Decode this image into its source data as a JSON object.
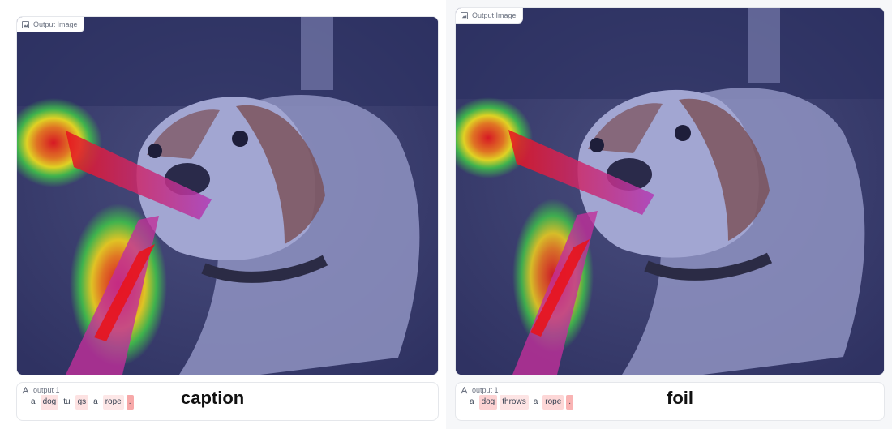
{
  "panels": [
    {
      "image_label": "Output Image",
      "text_label": "output 1",
      "tokens": [
        {
          "text": "a",
          "bg": "#ffffff"
        },
        {
          "text": "dog",
          "bg": "#fde2e2"
        },
        {
          "text": "tu",
          "bg": "#ffffff"
        },
        {
          "text": "gs",
          "bg": "#fde2e2"
        },
        {
          "text": "a",
          "bg": "#ffffff"
        },
        {
          "text": "rope",
          "bg": "#fde7e7"
        },
        {
          "text": ".",
          "bg": "#f7a8a8"
        }
      ],
      "caption": "caption"
    },
    {
      "image_label": "Output Image",
      "text_label": "output 1",
      "tokens": [
        {
          "text": "a",
          "bg": "#ffffff"
        },
        {
          "text": "dog",
          "bg": "#fcd2d2"
        },
        {
          "text": "throws",
          "bg": "#fde4e4"
        },
        {
          "text": "a",
          "bg": "#ffffff"
        },
        {
          "text": "rope",
          "bg": "#fdd7d7"
        },
        {
          "text": ".",
          "bg": "#f9b3b3"
        }
      ],
      "caption": "foil"
    }
  ],
  "colors": {
    "overlay": "#3d4170",
    "heat_red": "#e8141c",
    "heat_yellow": "#f2e21c",
    "heat_green": "#3fbf4a",
    "magenta": "#c0309a"
  },
  "icons": {
    "image": "image-icon",
    "text": "text-output-icon"
  }
}
